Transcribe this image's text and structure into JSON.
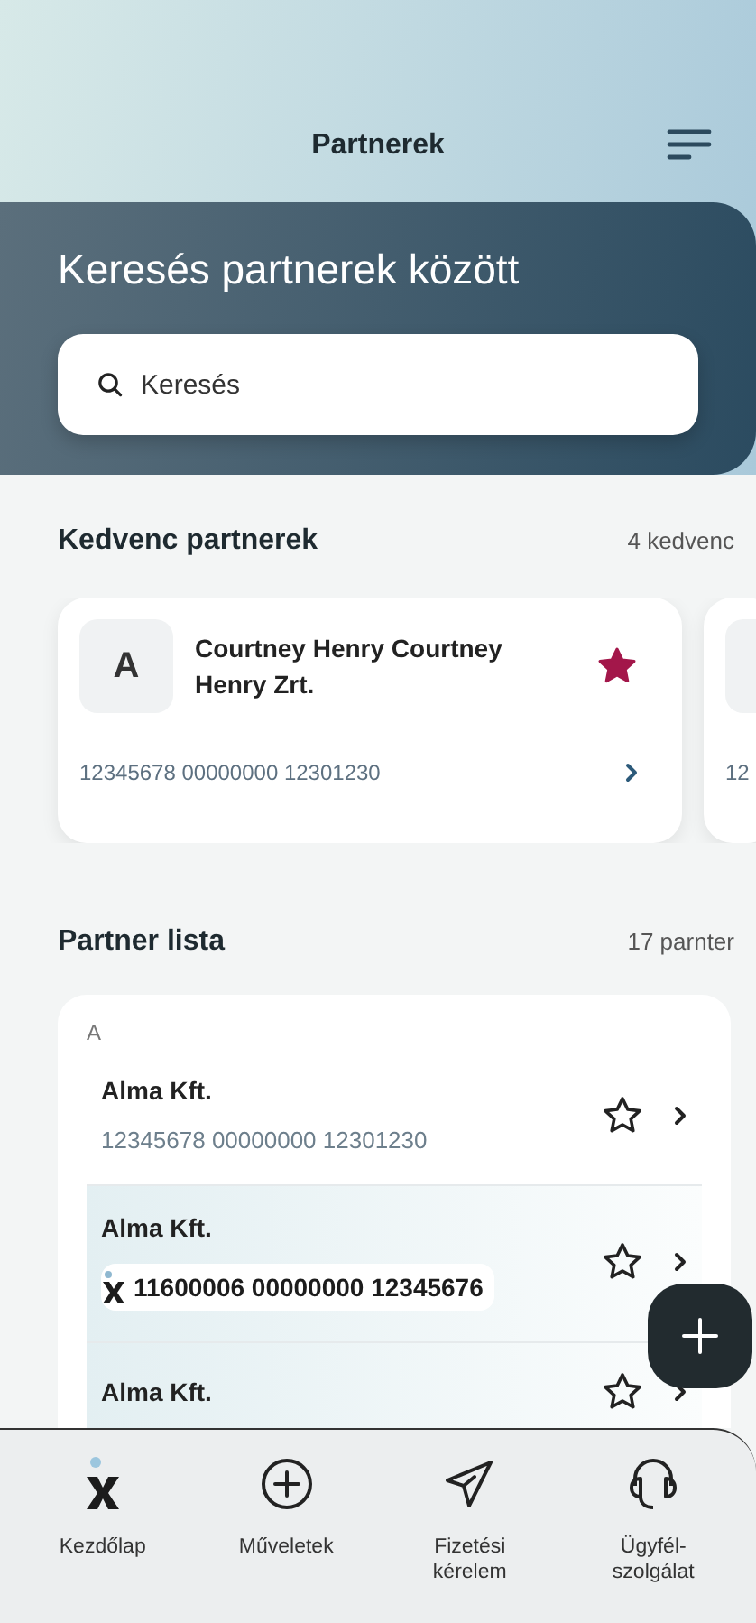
{
  "header": {
    "title": "Partnerek"
  },
  "search": {
    "heading": "Keresés partnerek között",
    "placeholder": "Keresés"
  },
  "favorites": {
    "title": "Kedvenc partnerek",
    "count": "4 kedvenc",
    "cards": [
      {
        "kind": "full",
        "initial": "A",
        "name": "Courtney Henry Courtney Henry Zrt.",
        "account": "12345678 00000000 12301230",
        "favorite": true
      },
      {
        "kind": "peek",
        "account": "12"
      }
    ]
  },
  "partners": {
    "title": "Partner lista",
    "count": "17 parnter",
    "groups": [
      {
        "letter": "A",
        "rows": [
          {
            "kind": "plain",
            "name": "Alma Kft.",
            "account": "12345678 00000000 12301230",
            "favorite": false
          },
          {
            "kind": "linked",
            "name": "Alma Kft.",
            "account": "11600006 00000000 12345676",
            "favorite": false
          },
          {
            "kind": "linked",
            "name": "Alma Kft.",
            "favorite": false
          }
        ]
      }
    ]
  },
  "nav": [
    {
      "kind": "home",
      "label": "Kezdőlap"
    },
    {
      "kind": "add",
      "label": "Műveletek"
    },
    {
      "kind": "send",
      "label": "Fizetési kérelem"
    },
    {
      "kind": "support",
      "label": "Ügyfél-szolgálat"
    }
  ]
}
